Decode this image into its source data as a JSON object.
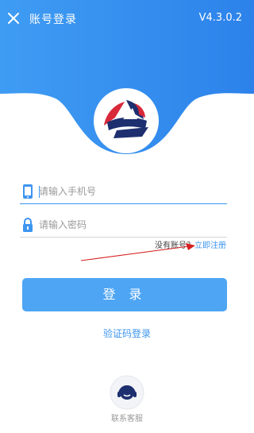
{
  "header": {
    "title": "账号登录",
    "version": "V4.3.0.2",
    "close_icon": "close-icon",
    "brand_color": "#3d95ef"
  },
  "form": {
    "phone_placeholder": "请输入手机号",
    "phone_icon": "phone-icon",
    "password_placeholder": "请输入密码",
    "password_icon": "lock-icon"
  },
  "register": {
    "question": "没有账号？",
    "link": "立即注册"
  },
  "login_button": "登 录",
  "sms_login": "验证码登录",
  "service": {
    "label": "联系客服",
    "icon": "headset-icon"
  },
  "annotation": {
    "arrow_color": "#d62020"
  }
}
